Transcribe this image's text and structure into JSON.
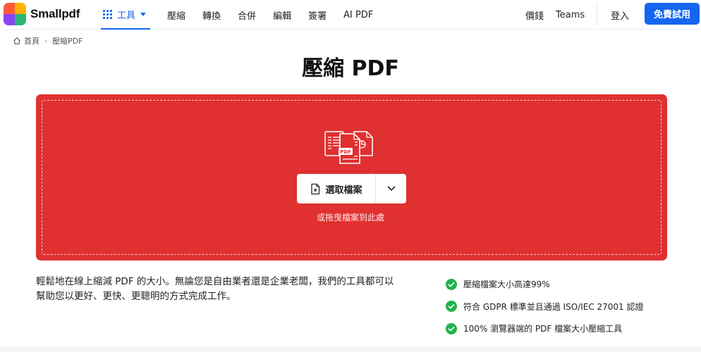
{
  "brand": {
    "name": "Smallpdf",
    "logo_colors": [
      "#ff5a3c",
      "#ffb000",
      "#8a45f5",
      "#2bb673"
    ]
  },
  "nav": {
    "tools_label": "工具",
    "items": [
      "壓縮",
      "轉換",
      "合併",
      "編輯",
      "簽署",
      "AI PDF"
    ],
    "pricing_label": "價錢",
    "teams_label": "Teams",
    "login_label": "登入",
    "trial_label": "免費試用"
  },
  "breadcrumb": {
    "home": "首頁",
    "current": "壓縮PDF"
  },
  "page": {
    "title": "壓縮 PDF"
  },
  "dropzone": {
    "choose_label": "選取檔案",
    "hint": "或拖曳檔案到此處",
    "file_icon_label": "PDF"
  },
  "description": "輕鬆地在線上縮減 PDF 的大小。無論您是自由業者還是企業老闆，我們的工具都可以幫助您以更好、更快、更聰明的方式完成工作。",
  "features": [
    "壓縮檔案大小高達99%",
    "符合 GDPR 標準並且通過 ISO/IEC 27001 認證",
    "100% 瀏覽器端的 PDF 檔案大小壓縮工具"
  ],
  "colors": {
    "accent": "#1966ee",
    "dropzone": "#e03030",
    "check": "#22b14c"
  }
}
